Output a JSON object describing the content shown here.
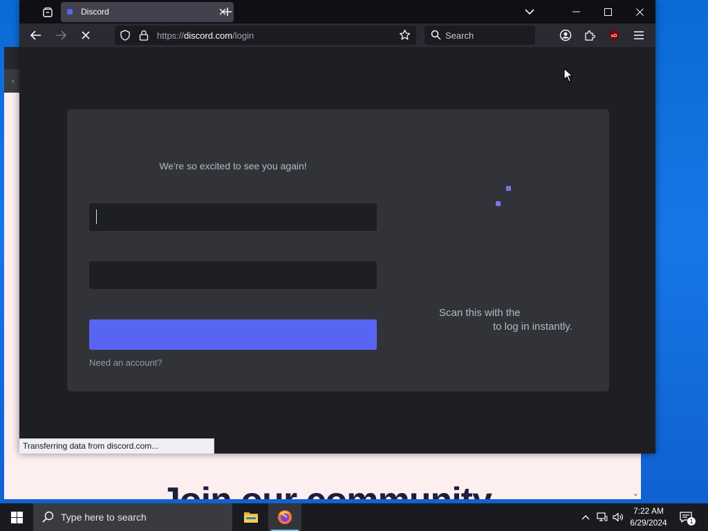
{
  "background_page": {
    "heading": "Join our community"
  },
  "browser": {
    "tab": {
      "title": "Discord"
    },
    "url": {
      "prefix": "https://",
      "domain": "discord.com",
      "path": "/login"
    },
    "search_placeholder": "Search",
    "status_text": "Transferring data from discord.com..."
  },
  "login": {
    "subtitle": "We're so excited to see you again!",
    "register_text": "Need an account?",
    "qr_line_1": "Scan this with the",
    "qr_line_2": "to log in instantly."
  },
  "taskbar": {
    "search_placeholder": "Type here to search",
    "time": "7:22 AM",
    "date": "6/29/2024",
    "notification_count": "1"
  },
  "colors": {
    "discord_blurple": "#5865f2",
    "desktop_blue": "#0a6ad6"
  }
}
